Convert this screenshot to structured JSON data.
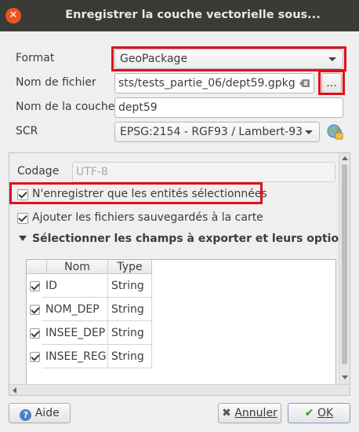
{
  "window": {
    "title": "Enregistrer la couche vectorielle sous..."
  },
  "form": {
    "format_label": "Format",
    "format_value": "GeoPackage",
    "filename_label": "Nom de fichier",
    "filename_value": "sts/tests_partie_06/dept59.gpkg",
    "browse_label": "...",
    "layername_label": "Nom de la couche",
    "layername_value": "dept59",
    "scr_label": "SCR",
    "scr_value": "EPSG:2154 - RGF93 / Lambert-93"
  },
  "options": {
    "codage_label": "Codage",
    "codage_value": "UTF-8",
    "save_selected_label": "N'enregistrer que les entités sélectionnées",
    "add_to_map_label": "Ajouter les fichiers sauvegardés à la carte",
    "fields_section_label": "Sélectionner les champs à exporter et leurs options d'e"
  },
  "table": {
    "headers": [
      "Nom",
      "Type"
    ],
    "rows": [
      {
        "name": "ID",
        "type": "String"
      },
      {
        "name": "NOM_DEP",
        "type": "String"
      },
      {
        "name": "INSEE_DEP",
        "type": "String"
      },
      {
        "name": "INSEE_REG",
        "type": "String"
      }
    ]
  },
  "buttons": {
    "help": "Aide",
    "cancel": "Annuler",
    "ok": "OK"
  },
  "colors": {
    "highlight": "#e0101c",
    "titlebar": "#3a3a37",
    "close": "#e95420"
  }
}
